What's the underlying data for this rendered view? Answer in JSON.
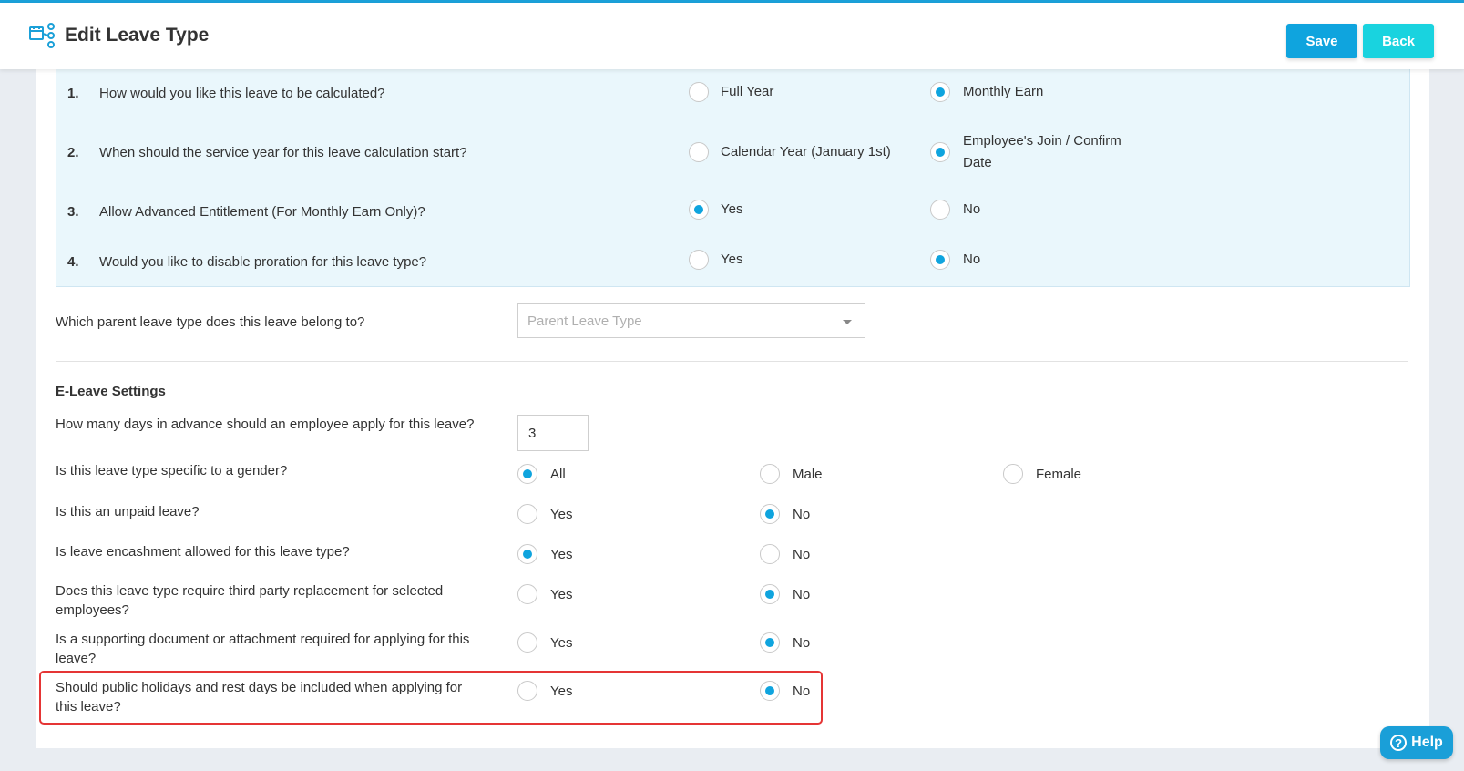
{
  "header": {
    "title": "Edit Leave Type",
    "save_label": "Save",
    "back_label": "Back"
  },
  "calc_questions": [
    {
      "num": "1.",
      "text": "How would you like this leave to be calculated?",
      "options": [
        "Full Year",
        "Monthly Earn"
      ],
      "selected": 1
    },
    {
      "num": "2.",
      "text": "When should the service year for this leave calculation start?",
      "options": [
        "Calendar Year (January 1st)",
        "Employee's Join / Confirm Date"
      ],
      "selected": 1
    },
    {
      "num": "3.",
      "text": "Allow Advanced Entitlement (For Monthly Earn Only)?",
      "options": [
        "Yes",
        "No"
      ],
      "selected": 0
    },
    {
      "num": "4.",
      "text": "Would you like to disable proration for this leave type?",
      "options": [
        "Yes",
        "No"
      ],
      "selected": 1
    }
  ],
  "parent": {
    "label": "Which parent leave type does this leave belong to?",
    "placeholder": "Parent Leave Type"
  },
  "eleave": {
    "title": "E-Leave Settings",
    "advance_label": "How many days in advance should an employee apply for this leave?",
    "advance_value": "3",
    "questions": [
      {
        "text": "Is this leave type specific to a gender?",
        "options": [
          "All",
          "Male",
          "Female"
        ],
        "selected": 0
      },
      {
        "text": "Is this an unpaid leave?",
        "options": [
          "Yes",
          "No"
        ],
        "selected": 1
      },
      {
        "text": "Is leave encashment allowed for this leave type?",
        "options": [
          "Yes",
          "No"
        ],
        "selected": 0
      },
      {
        "text": "Does this leave type require third party replacement for selected employees?",
        "options": [
          "Yes",
          "No"
        ],
        "selected": 1
      },
      {
        "text": "Is a supporting document or attachment required for applying for this leave?",
        "options": [
          "Yes",
          "No"
        ],
        "selected": 1
      },
      {
        "text": "Should public holidays and rest days be included when applying for this leave?",
        "options": [
          "Yes",
          "No"
        ],
        "selected": 1
      }
    ]
  },
  "help_label": "Help",
  "colors": {
    "accent": "#0fa4de",
    "back": "#19d3df",
    "panel": "#eaf7fc",
    "highlight": "#e53535"
  }
}
